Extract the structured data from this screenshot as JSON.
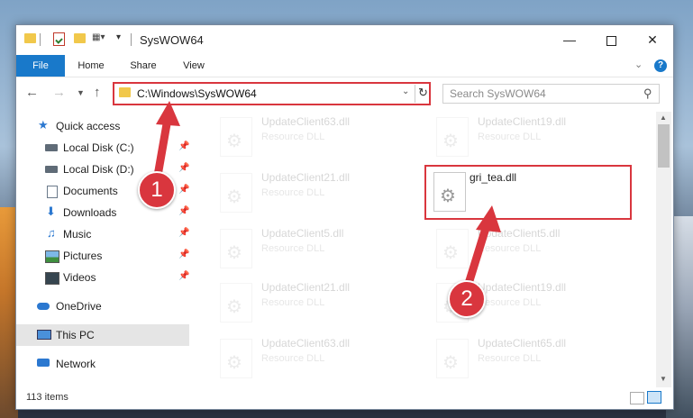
{
  "window": {
    "title": "SysWOW64"
  },
  "ribbon": {
    "tabs": [
      "File",
      "Home",
      "Share",
      "View"
    ],
    "help": "?"
  },
  "nav": {
    "address": "C:\\Windows\\SysWOW64",
    "search_placeholder": "Search SysWOW64"
  },
  "sidebar": {
    "items": [
      {
        "label": "Quick access",
        "pinned": false
      },
      {
        "label": "Local Disk (C:)",
        "pinned": true
      },
      {
        "label": "Local Disk (D:)",
        "pinned": true
      },
      {
        "label": "Documents",
        "pinned": true
      },
      {
        "label": "Downloads",
        "pinned": true
      },
      {
        "label": "Music",
        "pinned": true
      },
      {
        "label": "Pictures",
        "pinned": true
      },
      {
        "label": "Videos",
        "pinned": true
      },
      {
        "label": "OneDrive",
        "pinned": false
      },
      {
        "label": "This PC",
        "pinned": false
      },
      {
        "label": "Network",
        "pinned": false
      }
    ]
  },
  "files": [
    {
      "name": "UpdateClient63.dll",
      "type": "Resource DLL"
    },
    {
      "name": "UpdateClient19.dll",
      "type": "Resource DLL"
    },
    {
      "name": "UpdateClient21.dll",
      "type": "Resource DLL"
    },
    {
      "name": "gri_tea.dll",
      "type": ""
    },
    {
      "name": "UpdateClient5.dll",
      "type": "Resource DLL"
    },
    {
      "name": "UpdateClient5.dll",
      "type": "Resource DLL"
    },
    {
      "name": "UpdateClient21.dll",
      "type": "Resource DLL"
    },
    {
      "name": "UpdateClient19.dll",
      "type": "Resource DLL"
    },
    {
      "name": "UpdateClient63.dll",
      "type": "Resource DLL"
    },
    {
      "name": "UpdateClient65.dll",
      "type": "Resource DLL"
    }
  ],
  "status": {
    "item_count": "113 items"
  },
  "annotations": {
    "step1": "1",
    "step2": "2",
    "color": "#d9363e"
  }
}
